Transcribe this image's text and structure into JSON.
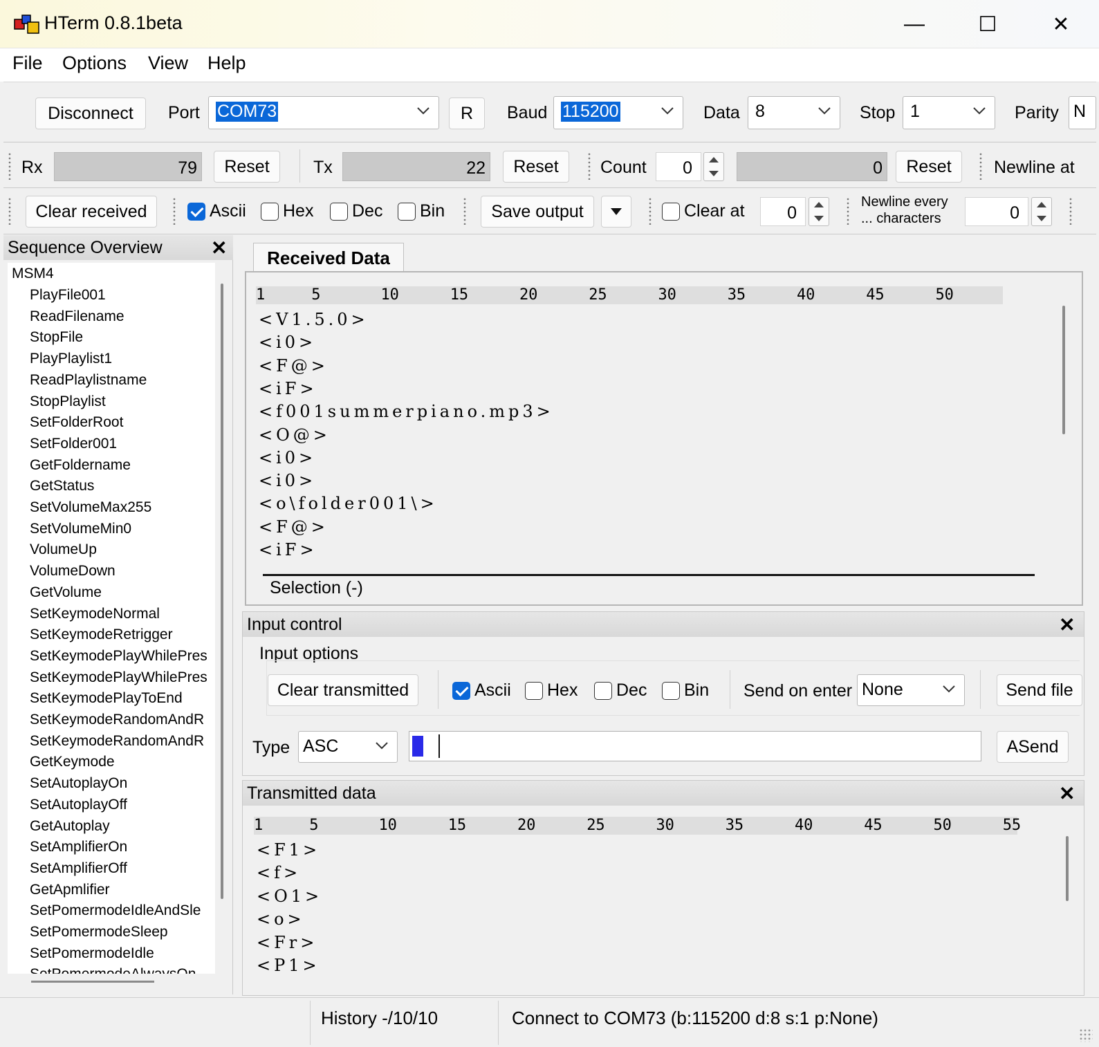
{
  "window": {
    "title": "HTerm 0.8.1beta",
    "minimize": "—",
    "maximize": "☐",
    "close": "✕"
  },
  "menu": [
    "File",
    "Options",
    "View",
    "Help"
  ],
  "connection": {
    "disconnect": "Disconnect",
    "port_label": "Port",
    "port_value": "COM73",
    "refresh": "R",
    "baud_label": "Baud",
    "baud_value": "115200",
    "data_label": "Data",
    "data_value": "8",
    "stop_label": "Stop",
    "stop_value": "1",
    "parity_label": "Parity",
    "parity_value": "N"
  },
  "counters": {
    "rx_label": "Rx",
    "rx_value": "79",
    "rx_reset": "Reset",
    "tx_label": "Tx",
    "tx_value": "22",
    "tx_reset": "Reset",
    "count_label": "Count",
    "count_value": "0",
    "count_gauge": "0",
    "count_reset": "Reset",
    "newline_at": "Newline at"
  },
  "recv_options": {
    "clear_received": "Clear received",
    "ascii": "Ascii",
    "hex": "Hex",
    "dec": "Dec",
    "bin": "Bin",
    "save_output": "Save output",
    "clear_at": "Clear at",
    "clear_at_value": "0",
    "newline_every_1": "Newline every",
    "newline_every_2": "... characters",
    "newline_every_value": "0"
  },
  "sequence": {
    "title": "Sequence Overview",
    "root": "MSM4",
    "items": [
      "PlayFile001",
      "ReadFilename",
      "StopFile",
      "PlayPlaylist1",
      "ReadPlaylistname",
      "StopPlaylist",
      "SetFolderRoot",
      "SetFolder001",
      "GetFoldername",
      "GetStatus",
      "SetVolumeMax255",
      "SetVolumeMin0",
      "VolumeUp",
      "VolumeDown",
      "GetVolume",
      "SetKeymodeNormal",
      "SetKeymodeRetrigger",
      "SetKeymodePlayWhilePres",
      "SetKeymodePlayWhilePres",
      "SetKeymodePlayToEnd",
      "SetKeymodeRandomAndR",
      "SetKeymodeRandomAndR",
      "GetKeymode",
      "SetAutoplayOn",
      "SetAutoplayOff",
      "GetAutoplay",
      "SetAmplifierOn",
      "SetAmplifierOff",
      "GetApmlifier",
      "SetPomermodeIdleAndSle",
      "SetPomermodeSleep",
      "SetPomermodeIdle",
      "SetPomermodeAlwaysOn"
    ]
  },
  "received": {
    "tab": "Received Data",
    "ruler": [
      "1",
      "5",
      "10",
      "15",
      "20",
      "25",
      "30",
      "35",
      "40",
      "45",
      "50"
    ],
    "lines": [
      "<V1.5.0>",
      "<i0>",
      "<F@>",
      "<iF>",
      "<f001summerpiano.mp3>",
      "<O@>",
      "<i0>",
      "<i0>",
      "<o\\folder001\\>",
      "<F@>",
      "<iF>"
    ],
    "selection": "Selection (-)"
  },
  "input": {
    "title": "Input control",
    "options_label": "Input options",
    "clear_transmitted": "Clear transmitted",
    "ascii": "Ascii",
    "hex": "Hex",
    "dec": "Dec",
    "bin": "Bin",
    "send_on_enter_label": "Send on enter",
    "send_on_enter_value": "None",
    "send_file": "Send file",
    "type_label": "Type",
    "type_value": "ASC",
    "asend": "ASend"
  },
  "transmitted": {
    "title": "Transmitted data",
    "ruler": [
      "1",
      "5",
      "10",
      "15",
      "20",
      "25",
      "30",
      "35",
      "40",
      "45",
      "50",
      "55"
    ],
    "lines": [
      "<F1>",
      "<f>",
      "<O1>",
      "<o>",
      "<Fr>",
      "<P1>"
    ]
  },
  "status": {
    "history": "History -/10/10",
    "connection": "Connect to COM73 (b:115200 d:8 s:1 p:None)"
  }
}
